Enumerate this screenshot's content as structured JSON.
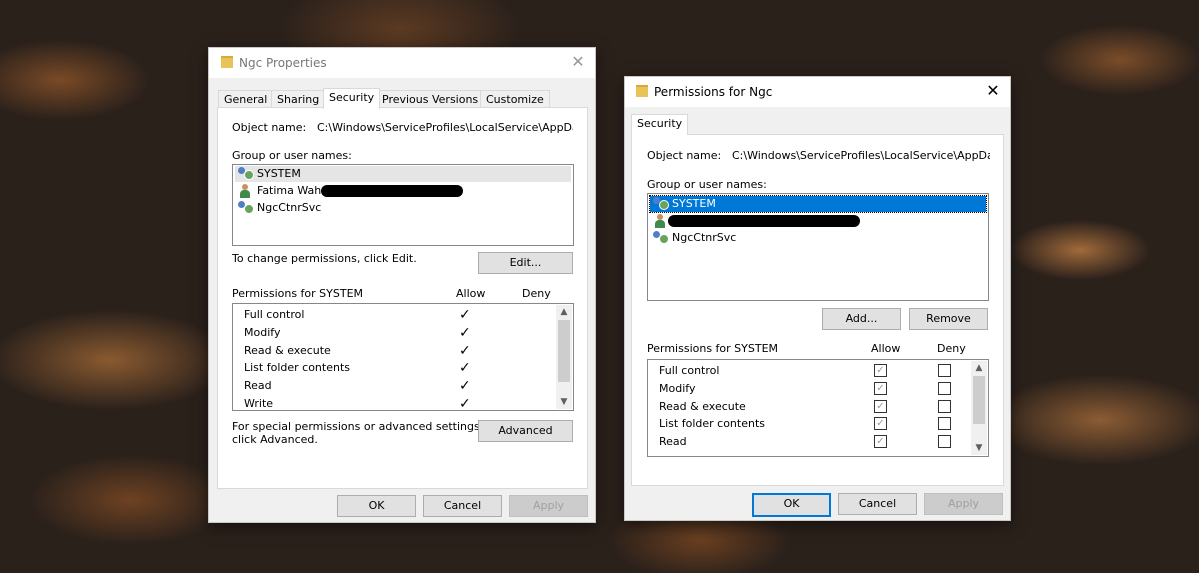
{
  "props": {
    "title": "Ngc Properties",
    "tabs": [
      "General",
      "Sharing",
      "Security",
      "Previous Versions",
      "Customize"
    ],
    "object_name_label": "Object name:",
    "object_name_value": "C:\\Windows\\ServiceProfiles\\LocalService\\AppData\\Lo",
    "group_label": "Group or user names:",
    "users": [
      "SYSTEM",
      "Fatima Wahab",
      "NgcCtnrSvc"
    ],
    "change_text": "To change permissions, click Edit.",
    "edit_label": "Edit...",
    "perm_header": "Permissions for SYSTEM",
    "allow": "Allow",
    "deny": "Deny",
    "permissions": [
      "Full control",
      "Modify",
      "Read & execute",
      "List folder contents",
      "Read",
      "Write"
    ],
    "check_glyph": "✓",
    "special_text_1": "For special permissions or advanced settings,",
    "special_text_2": "click Advanced.",
    "advanced_label": "Advanced",
    "ok": "OK",
    "cancel": "Cancel",
    "apply": "Apply"
  },
  "perm_dialog": {
    "title": "Permissions for Ngc",
    "tab": "Security",
    "object_name_label": "Object name:",
    "object_name_value": "C:\\Windows\\ServiceProfiles\\LocalService\\AppData\\Lo",
    "group_label": "Group or user names:",
    "users": [
      "SYSTEM",
      "NgcCtnrSvc"
    ],
    "add_label": "Add...",
    "remove_label": "Remove",
    "perm_header": "Permissions for SYSTEM",
    "allow": "Allow",
    "deny": "Deny",
    "permissions": [
      "Full control",
      "Modify",
      "Read & execute",
      "List folder contents",
      "Read"
    ],
    "check_glyph": "✓",
    "ok": "OK",
    "cancel": "Cancel",
    "apply": "Apply"
  },
  "icons": {
    "close": "✕",
    "scroll_up": "▲",
    "scroll_down": "▼"
  },
  "colors": {
    "selection_blue": "#0078d7",
    "window_bg": "#f0f0f0"
  }
}
